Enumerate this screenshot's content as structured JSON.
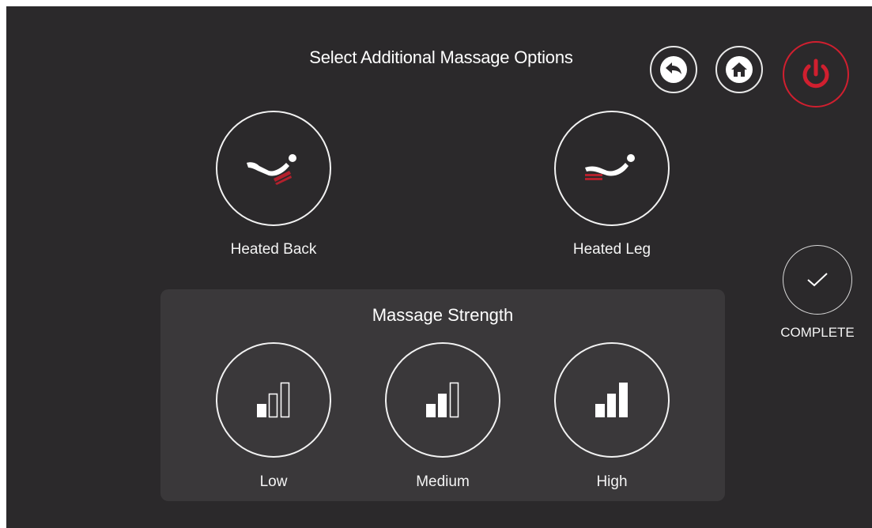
{
  "header": {
    "title": "Select Additional Massage Options",
    "back_icon": "back-arrow-icon",
    "home_icon": "home-icon",
    "power_icon": "power-icon"
  },
  "options": [
    {
      "label": "Heated Back",
      "icon": "heated-back-icon"
    },
    {
      "label": "Heated Leg",
      "icon": "heated-leg-icon"
    }
  ],
  "strength": {
    "title": "Massage Strength",
    "levels": [
      {
        "label": "Low",
        "icon": "signal-low-icon",
        "filled_bars": 1
      },
      {
        "label": "Medium",
        "icon": "signal-medium-icon",
        "filled_bars": 2
      },
      {
        "label": "High",
        "icon": "signal-high-icon",
        "filled_bars": 3
      }
    ]
  },
  "complete": {
    "label": "COMPLETE",
    "icon": "checkmark-icon"
  },
  "colors": {
    "background": "#2b292b",
    "panel": "#3a383a",
    "accent_red": "#d01f2f",
    "heat_red": "#b3202c"
  }
}
